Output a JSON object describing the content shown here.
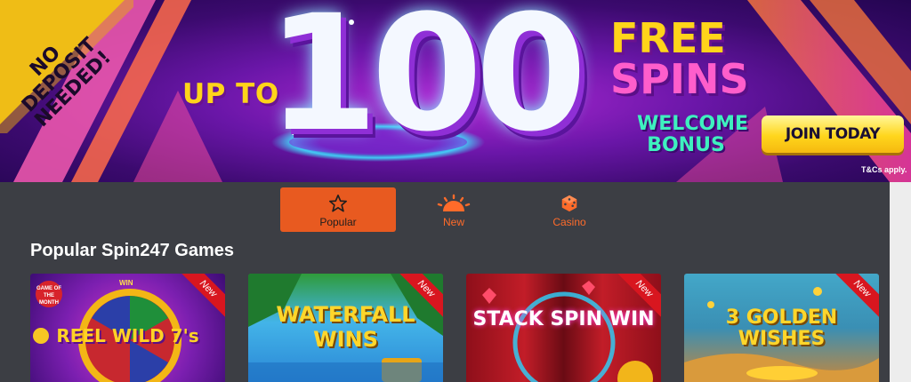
{
  "banner": {
    "corner_text": "NO DEPOSIT NEEDED!",
    "up_to": "UP TO",
    "amount": "100",
    "free": "FREE",
    "spins": "SPINS",
    "welcome_bonus": "WELCOME BONUS",
    "cta": "JOIN TODAY",
    "terms": "T&Cs apply."
  },
  "tabs": [
    {
      "label": "Popular",
      "icon": "star-icon",
      "active": true
    },
    {
      "label": "New",
      "icon": "sunrise-icon",
      "active": false
    },
    {
      "label": "Casino",
      "icon": "dice-icon",
      "active": false
    }
  ],
  "section_title": "Popular Spin247 Games",
  "games": [
    {
      "title": "REEL WILD 7's",
      "badge": "New",
      "tag_top": "GAME OF THE MONTH",
      "tag_win": "WIN"
    },
    {
      "title": "WATERFALL WINS",
      "badge": "New"
    },
    {
      "title": "STACK SPIN WIN",
      "badge": "New"
    },
    {
      "title": "3 GOLDEN WISHES",
      "badge": "New"
    }
  ],
  "colors": {
    "accent": "#e85a20",
    "panel_bg": "#3c3e44",
    "cta_yellow": "#ffd61c",
    "badge_red": "#d8161f"
  }
}
